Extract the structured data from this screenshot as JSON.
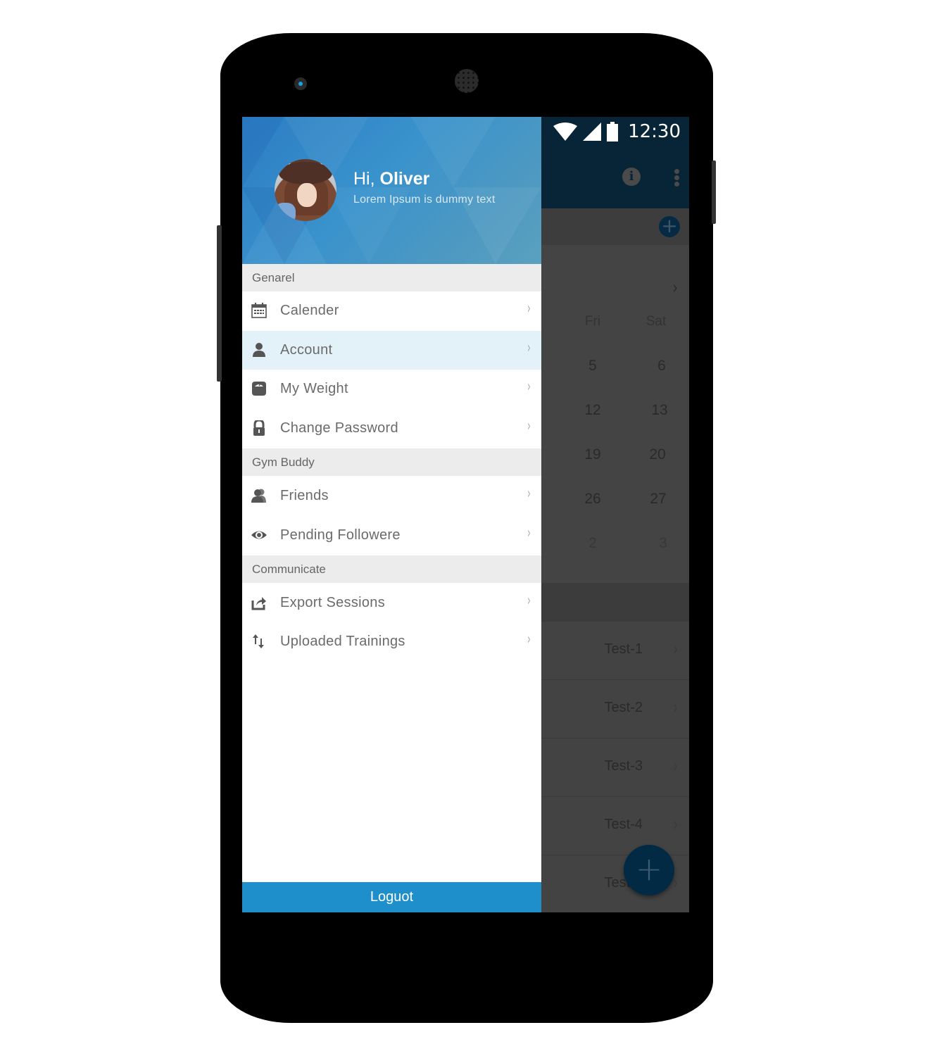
{
  "status_bar": {
    "time": "12:30",
    "icons": [
      "wifi-icon",
      "signal-icon",
      "battery-icon"
    ]
  },
  "toolbar": {
    "icons": [
      "info-icon",
      "more-vert-icon"
    ],
    "add_icon": "+"
  },
  "calendar": {
    "next_icon": "›",
    "day_names": [
      "Fri",
      "Sat"
    ],
    "weeks": [
      [
        "5",
        "6"
      ],
      [
        "12",
        "13"
      ],
      [
        "19",
        "20"
      ],
      [
        "26",
        "27"
      ],
      [
        "2",
        "3"
      ]
    ]
  },
  "sessions": {
    "items": [
      "Test-1",
      "Test-2",
      "Test-3",
      "Test-4",
      "Test-5"
    ],
    "chevron": "›",
    "fab_icon": "+"
  },
  "drawer": {
    "header": {
      "greeting_prefix": "Hi,",
      "user_name": "Oliver",
      "subtitle": "Lorem Ipsum is dummy text"
    },
    "sections": [
      {
        "title": "Genarel",
        "items": [
          {
            "label": "Calender",
            "icon": "calendar-icon"
          },
          {
            "label": "Account",
            "icon": "person-icon",
            "active": true
          },
          {
            "label": "My Weight",
            "icon": "weight-scale-icon"
          },
          {
            "label": "Change Password",
            "icon": "lock-icon"
          }
        ]
      },
      {
        "title": "Gym Buddy",
        "items": [
          {
            "label": "Friends",
            "icon": "friends-icon"
          },
          {
            "label": "Pending Followere",
            "icon": "eye-icon"
          }
        ]
      },
      {
        "title": "Communicate",
        "items": [
          {
            "label": "Export Sessions",
            "icon": "export-icon"
          },
          {
            "label": "Uploaded Trainings",
            "icon": "sort-arrows-icon"
          }
        ]
      }
    ],
    "chevron": "›",
    "logout_label": "Loguot"
  },
  "colors": {
    "accent": "#1f8fcc",
    "toolbar": "#082537",
    "active_item_bg": "#e3f1f8",
    "section_bg": "#ececec"
  }
}
